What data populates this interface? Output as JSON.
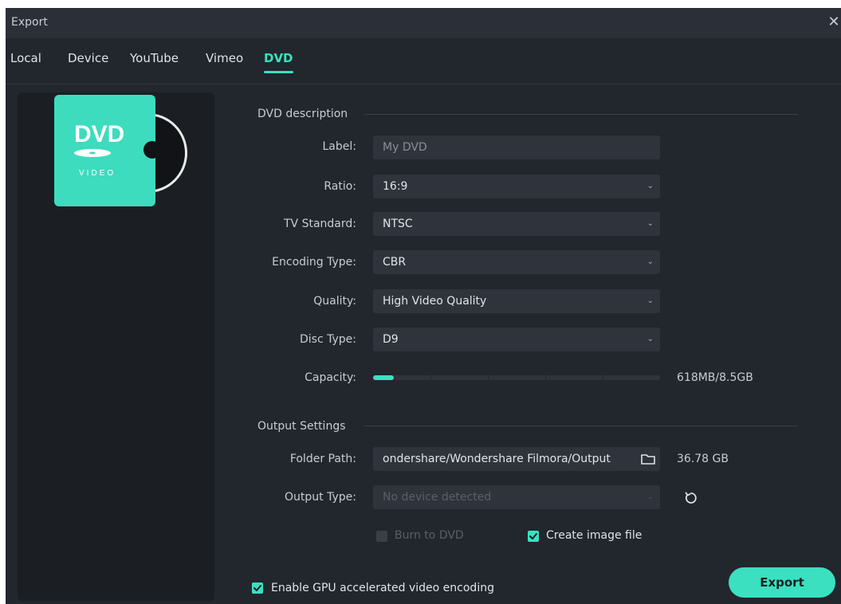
{
  "window": {
    "title": "Export",
    "close": "✕"
  },
  "tabs": [
    {
      "label": "Local"
    },
    {
      "label": "Device"
    },
    {
      "label": "YouTube"
    },
    {
      "label": "Vimeo"
    },
    {
      "label": "DVD",
      "active": true
    }
  ],
  "dvd_logo": {
    "big": "DVD",
    "small": "VIDEO"
  },
  "dvd_description": {
    "section_title": "DVD description",
    "label": {
      "label": "Label:",
      "value": "My DVD"
    },
    "ratio": {
      "label": "Ratio:",
      "value": "16:9"
    },
    "tv_standard": {
      "label": "TV Standard:",
      "value": "NTSC"
    },
    "encoding_type": {
      "label": "Encoding Type:",
      "value": "CBR"
    },
    "quality": {
      "label": "Quality:",
      "value": "High Video Quality"
    },
    "disc_type": {
      "label": "Disc Type:",
      "value": "D9"
    },
    "capacity": {
      "label": "Capacity:",
      "value": "618MB/8.5GB",
      "fraction": 0.071
    }
  },
  "output_settings": {
    "section_title": "Output Settings",
    "folder_path": {
      "label": "Folder Path:",
      "value": "ondershare/Wondershare Filmora/Output",
      "free_space": "36.78 GB"
    },
    "output_type": {
      "label": "Output Type:",
      "placeholder": "No device detected"
    },
    "burn_to_dvd": {
      "label": "Burn to DVD",
      "checked": false
    },
    "create_image_file": {
      "label": "Create image file",
      "checked": true
    }
  },
  "footer": {
    "gpu_label": "Enable GPU accelerated video encoding",
    "gpu_checked": true,
    "export_label": "Export"
  },
  "colors": {
    "accent": "#3ae0c0",
    "background": "#22262d",
    "field": "#2f343c",
    "panel": "#1b1e23"
  },
  "icons": {
    "folder": "folder-icon",
    "refresh": "refresh-icon",
    "chevron": "chevron-down-icon",
    "check": "check-icon"
  }
}
